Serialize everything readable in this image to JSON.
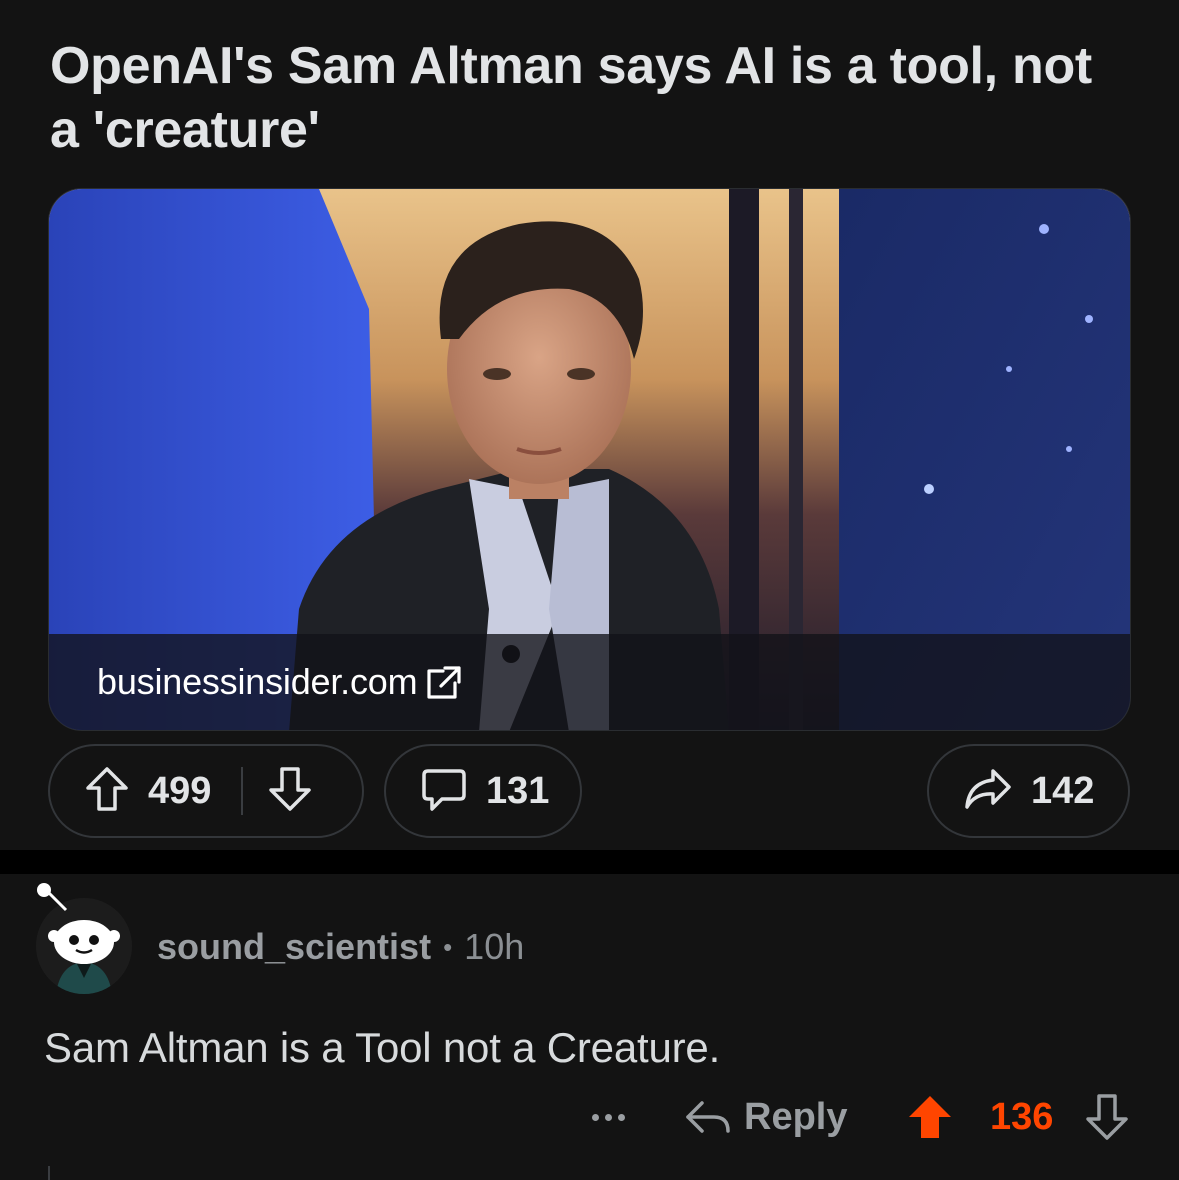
{
  "post": {
    "title": "OpenAI's Sam Altman says AI is a tool, not a 'creature'",
    "link": {
      "domain": "businessinsider.com",
      "icon": "external-link-icon",
      "thumbnail": "photo of a man in a dark suit jacket and light blue shirt against a blue and sunset-toned stage backdrop"
    },
    "actions": {
      "upvote_icon": "arrow-up-outline-icon",
      "score": "499",
      "downvote_icon": "arrow-down-outline-icon",
      "comments_icon": "speech-bubble-icon",
      "comment_count": "131",
      "share_icon": "share-arrow-icon",
      "share_count": "142"
    }
  },
  "comment": {
    "avatar_icon": "snoo-avatar-icon",
    "author": "sound_scientist",
    "separator": "•",
    "time": "10h",
    "body": "Sam Altman is a Tool not a Creature.",
    "actions": {
      "more_icon": "more-dots-icon",
      "reply_label": "Reply",
      "reply_icon": "reply-arrow-icon",
      "upvote_icon": "arrow-up-filled-icon",
      "score": "136",
      "downvote_icon": "arrow-down-outline-icon"
    }
  },
  "colors": {
    "background": "#131313",
    "upvoted": "#ff4500",
    "text": "#d7dadc",
    "muted": "#8b8f93"
  }
}
